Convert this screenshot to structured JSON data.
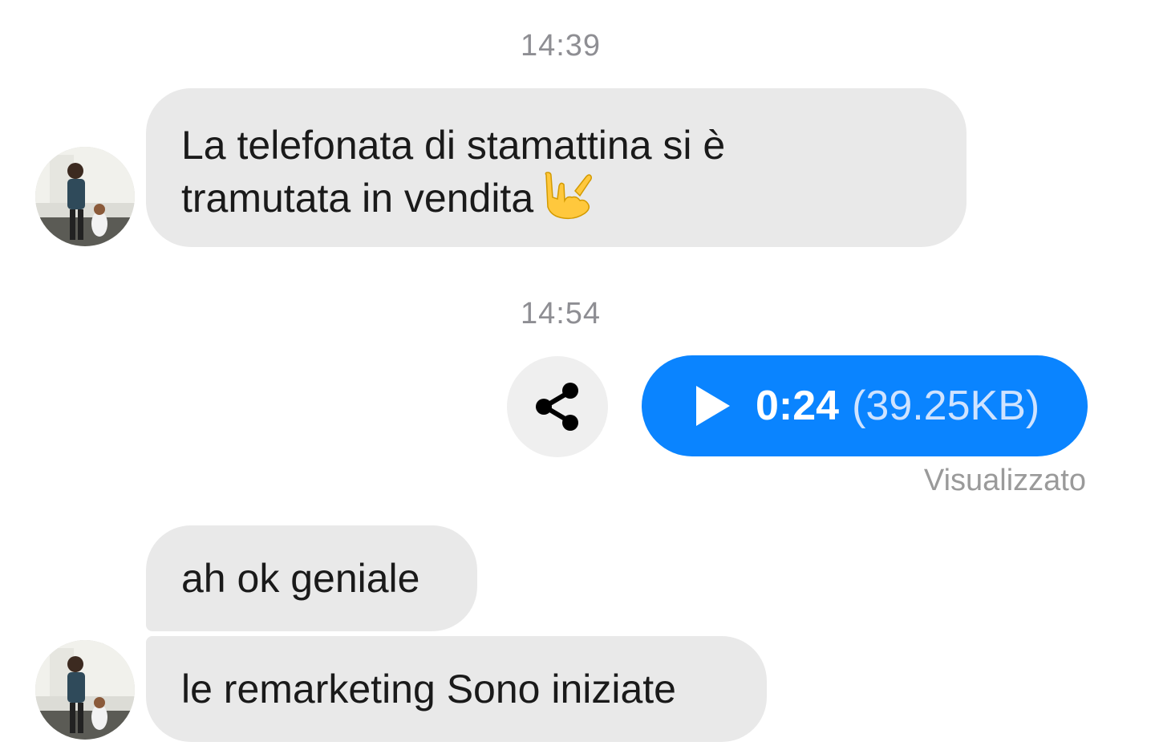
{
  "messages": {
    "timestamp_1": "14:39",
    "incoming_1": {
      "line_1": "La telefonata di stamattina si è",
      "line_2": "tramutata in vendita",
      "emoji": "sign-of-the-horns-icon"
    },
    "timestamp_2": "14:54",
    "outgoing_audio": {
      "duration": "0:24",
      "size": "(39.25KB)",
      "play_icon": "play-icon",
      "share_icon": "share-icon",
      "status": "Visualizzato"
    },
    "incoming_2": "ah ok geniale",
    "incoming_3": "le remarketing Sono iniziate"
  },
  "colors": {
    "outgoing_bubble": "#0a84ff",
    "incoming_bubble": "#e9e9e9",
    "timestamp_text": "#8e8e93"
  }
}
